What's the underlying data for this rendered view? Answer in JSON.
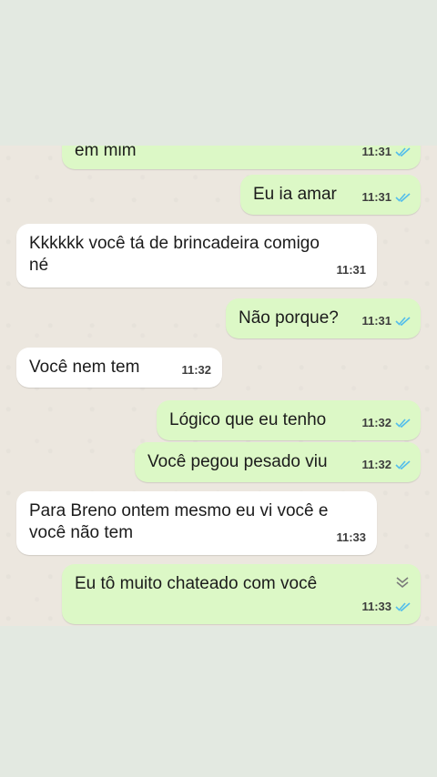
{
  "messages": [
    {
      "dir": "out",
      "text": "em mim",
      "time": "11:31",
      "read": true
    },
    {
      "dir": "out",
      "text": "Eu ia amar",
      "time": "11:31",
      "read": true
    },
    {
      "dir": "in",
      "text": "Kkkkkk você tá de brincadeira comigo né",
      "time": "11:31"
    },
    {
      "dir": "out",
      "text": "Não porque?",
      "time": "11:31",
      "read": true
    },
    {
      "dir": "in",
      "text": "Você nem tem",
      "time": "11:32"
    },
    {
      "dir": "out",
      "text": "Lógico que eu tenho",
      "time": "11:32",
      "read": true
    },
    {
      "dir": "out",
      "text": "Você pegou pesado viu",
      "time": "11:32",
      "read": true
    },
    {
      "dir": "in",
      "text": "Para Breno ontem mesmo eu vi você e você não tem",
      "time": "11:33"
    },
    {
      "dir": "out",
      "text": "Eu tô muito chateado com você",
      "time": "11:33",
      "read": true
    }
  ],
  "icons": {
    "read_receipt": "double-check-icon",
    "menu": "chevron-down-icon"
  },
  "colors": {
    "outgoing": "#dcf8c6",
    "incoming": "#ffffff",
    "ticks": "#53bdeb",
    "background": "#ece7df"
  }
}
